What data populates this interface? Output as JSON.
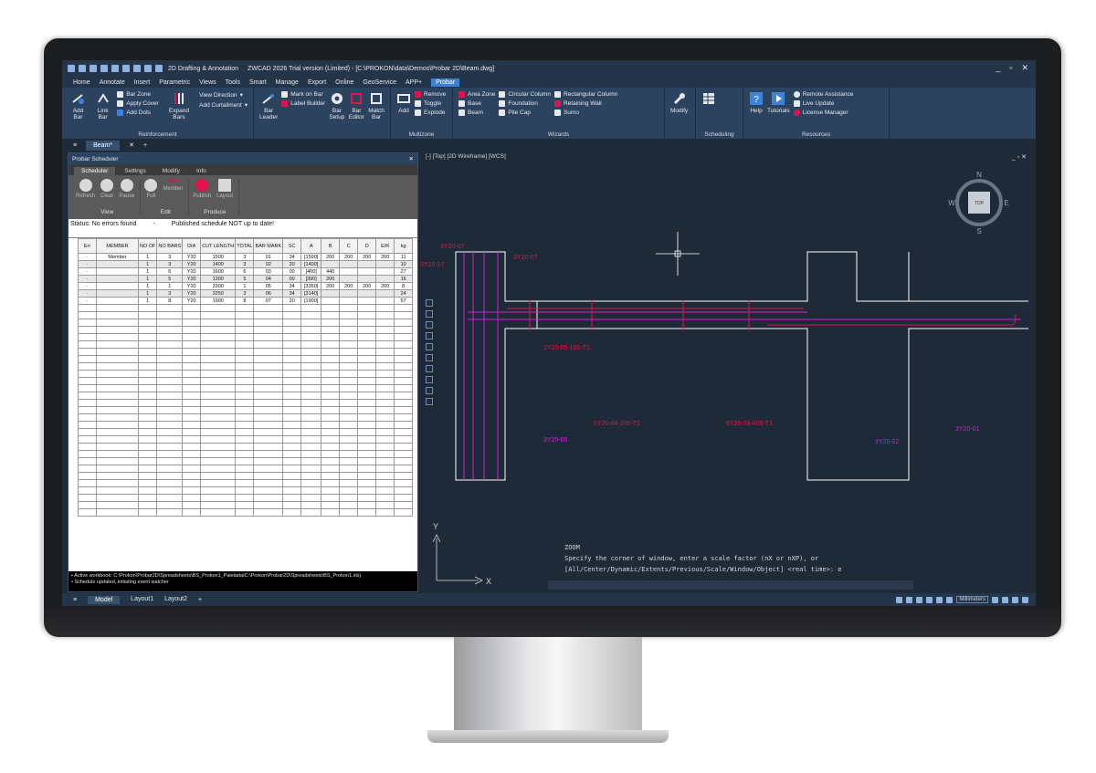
{
  "window": {
    "workspace": "2D Drafting & Annotation",
    "title": "ZWCAD 2026 Trial version (Limited) - [C:\\PROKON\\data\\Demos\\Probar 2D\\Beam.dwg]"
  },
  "menu": [
    "Home",
    "Annotate",
    "Insert",
    "Parametric",
    "Views",
    "Tools",
    "Smart",
    "Manage",
    "Export",
    "Online",
    "GeoService",
    "APP+",
    "Probar"
  ],
  "menu_active": "Probar",
  "ribbon": {
    "add_bar": "Add Bar",
    "link_bar": "Link Bar",
    "bar_zone": "Bar Zone",
    "apply_cover": "Apply Cover",
    "add_dots": "Add Dots",
    "expand_bars": "Expand Bars",
    "view_direction": "View Direction",
    "add_curtailment": "Add Curtailment",
    "bar_leader": "Bar Leader",
    "mark_on_bar": "Mark on Bar",
    "label_builder": "Label Builder",
    "bar_setup": "Bar Setup",
    "bar_editor": "Bar Editor",
    "match_bar": "Match Bar",
    "reinforcement": "Reinforcement",
    "add": "Add",
    "remove": "Remove",
    "toggle": "Toggle",
    "explode": "Explode",
    "multizone": "Multizone",
    "area_zone": "Area Zone",
    "circular_column": "Circular Column",
    "rectangular_column": "Rectangular Column",
    "base": "Base",
    "foundation": "Foundation",
    "retaining_wall": "Retaining Wall",
    "beam": "Beam",
    "pile_cap": "Pile Cap",
    "sumo": "Sumo",
    "wizards": "Wizards",
    "modify": "Modify",
    "scheduling": "Scheduling",
    "help": "Help",
    "tutorials": "Tutorials",
    "remote_assistance": "Remote Assistance",
    "live_update": "Live Update",
    "license_manager": "License Manager",
    "resources": "Resources"
  },
  "doc_tab": "Beam*",
  "panel": {
    "title": "Probar Scheduler",
    "tabs": [
      "Scheduler",
      "Settings",
      "Modify",
      "Info"
    ],
    "tools": {
      "refresh": "Refresh",
      "clear": "Clear",
      "pause": "Pause",
      "view": "View",
      "full": "Full",
      "member": "Member",
      "new": "NEW",
      "edit": "Edit",
      "publish": "Publish",
      "layout": "Layout",
      "produce": "Produce"
    },
    "status": "Status: No errors found",
    "dash": "-",
    "published": "Published schedule NOT up to date!",
    "columns": [
      "Err",
      "MEMBER",
      "NO OF",
      "NO BARS",
      "DIA",
      "CUT LENGTH",
      "TOTAL",
      "BAR MARK",
      "SC",
      "A",
      "B",
      "C",
      "D",
      "E/R",
      "kg"
    ],
    "rows": [
      [
        "·",
        "Member",
        "1",
        "3",
        "Y20",
        "1500",
        "3",
        "01",
        "34",
        "[1590]",
        "200",
        "200",
        "200",
        "200",
        "11"
      ],
      [
        "·",
        "",
        "1",
        "3",
        "Y20",
        "1400",
        "3",
        "02",
        "20",
        "[1400]",
        "",
        "",
        "",
        "",
        "10"
      ],
      [
        "·",
        "",
        "1",
        "6",
        "Y20",
        "1600",
        "6",
        "03",
        "00",
        "[400]",
        "440",
        "",
        "",
        "",
        "27"
      ],
      [
        "·",
        "",
        "1",
        "5",
        "Y20",
        "1300",
        "5",
        "04",
        "00",
        "[390]",
        "200",
        "",
        "",
        "",
        "16"
      ],
      [
        "·",
        "",
        "1",
        "1",
        "Y20",
        "3300",
        "1",
        "05",
        "34",
        "[3350]",
        "200",
        "200",
        "200",
        "200",
        "8"
      ],
      [
        "·",
        "",
        "1",
        "3",
        "Y20",
        "3250",
        "3",
        "06",
        "34",
        "[3140]",
        "",
        "",
        "",
        "",
        "24"
      ],
      [
        "·",
        "",
        "1",
        "8",
        "Y20",
        "1900",
        "8",
        "07",
        "20",
        "[1900]",
        "",
        "",
        "",
        "",
        "57"
      ]
    ],
    "log": [
      "• Active workbook: C:\\Prokon\\Probar2D\\Spreadsheets\\BS_Prokon1_PaletaitaIC:\\Prokon\\Probar2D\\Spreadsheets\\BS_Prokon1.xls)",
      "• Schedule updated, initiating event watcher"
    ]
  },
  "viewport": {
    "label": "[-] [Top] [2D Wireframe] [WCS]",
    "compass": {
      "n": "N",
      "s": "S",
      "e": "E",
      "w": "W",
      "top": "TOP"
    },
    "axis": {
      "x": "X",
      "y": "Y"
    },
    "bar_labels": [
      "3Y20-07",
      "3Y20-07",
      "3Y20-07",
      "1Y20-05-100-T1",
      "5Y20-04-250-T1",
      "6Y20-03-400-T1",
      "3Y20-06",
      "3Y20-02",
      "3Y20-01"
    ]
  },
  "command": {
    "line1": "ZOOM",
    "line2": "Specify the corner of window, enter a scale factor (nX or nXP), or",
    "line3": "[All/Center/Dynamic/Extents/Previous/Scale/Window/Object] <real time>: e"
  },
  "status_tabs": [
    "Model",
    "Layout1",
    "Layout2"
  ],
  "units": "Millimeters",
  "colors": {
    "accent": "#3d82d6",
    "drawing_bg": "#1f2a38",
    "bar_red": "#e0144c",
    "bar_magenta": "#d41fd4",
    "outline": "#ffffff"
  }
}
